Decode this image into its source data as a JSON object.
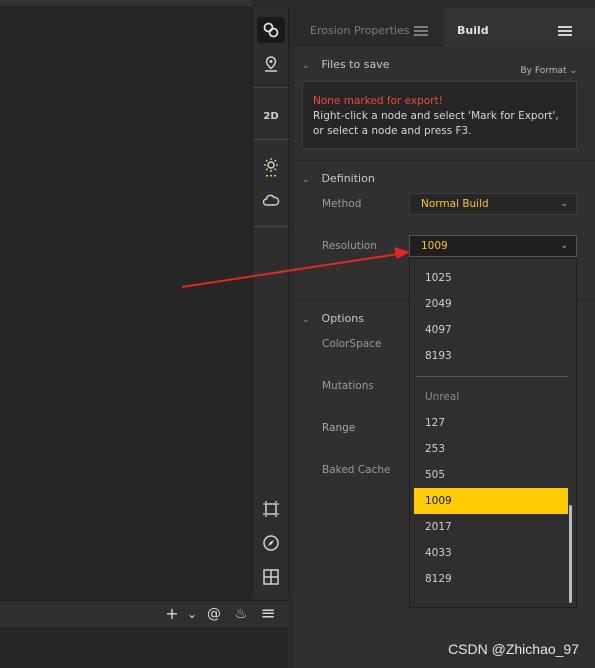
{
  "tabs": [
    {
      "label": "Erosion Properties",
      "active": false
    },
    {
      "label": "Build",
      "active": true
    }
  ],
  "toolbar": {
    "items": [
      {
        "name": "graph-link-icon",
        "glyph": "⛓"
      },
      {
        "name": "location-pin-icon",
        "glyph": "⌖"
      },
      {
        "name": "2d-view-toggle",
        "glyph": "2D"
      },
      {
        "name": "sun-lighting-icon",
        "glyph": "☼"
      },
      {
        "name": "cloud-icon",
        "glyph": "☁"
      },
      {
        "name": "frame-select-icon",
        "glyph": "⬚"
      },
      {
        "name": "compass-icon",
        "glyph": "⊘"
      },
      {
        "name": "grid-layout-icon",
        "glyph": "⊞"
      }
    ],
    "two_d_label": "2D"
  },
  "bottom_bar": {
    "icons": [
      "add-icon",
      "chevron-down-icon",
      "at-icon",
      "flame-icon",
      "menu-icon"
    ],
    "add_glyph": "+",
    "chevron_glyph": "⌄",
    "at_glyph": "@",
    "flame_glyph": "♨",
    "menu_glyph": "≡"
  },
  "files_to_save": {
    "title": "Files to save",
    "format_label": "By Format",
    "warning": "None marked for export!",
    "help": "Right-click a node and select 'Mark for Export', or select a node and press F3."
  },
  "definition": {
    "title": "Definition",
    "method_label": "Method",
    "method_value": "Normal Build",
    "resolution_label": "Resolution",
    "resolution_value": "1009"
  },
  "options": {
    "title": "Options",
    "colorspace_label": "ColorSpace",
    "mutations_label": "Mutations",
    "range_label": "Range",
    "baked_cache_label": "Baked Cache"
  },
  "resolution_dropdown": {
    "items_top": [
      "1025",
      "2049",
      "4097",
      "8193"
    ],
    "group_label": "Unreal",
    "items_unreal": [
      "127",
      "253",
      "505",
      "1009",
      "2017",
      "4033",
      "8129"
    ],
    "selected": "1009"
  },
  "watermark": "CSDN @Zhichao_97",
  "colors": {
    "accent": "#ffcc00",
    "value_text": "#f5c422",
    "warning": "#f04b36",
    "annotation_arrow": "#e8261e"
  }
}
